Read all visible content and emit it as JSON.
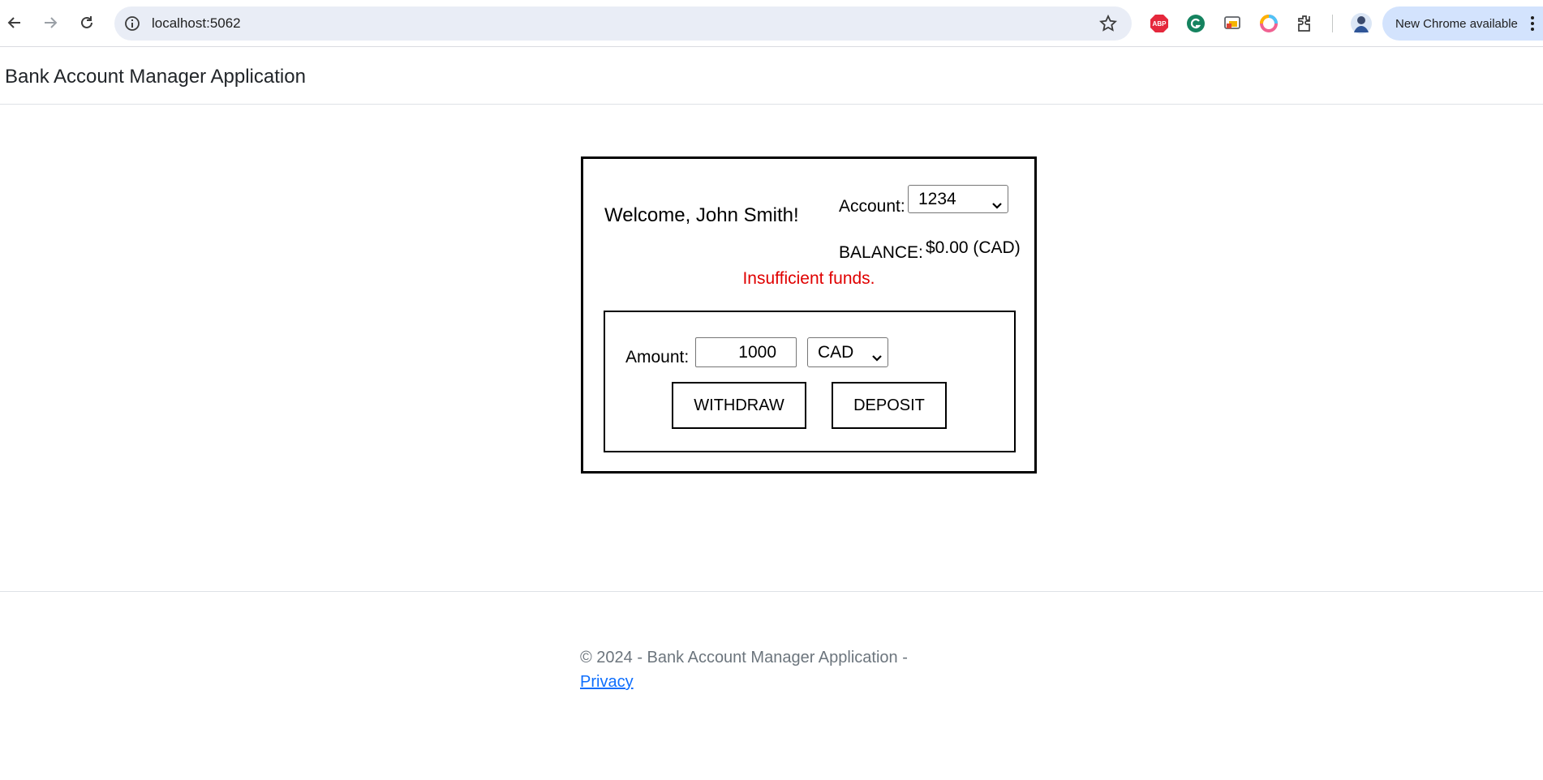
{
  "browser": {
    "url": "localhost:5062",
    "update_label": "New Chrome available",
    "extensions": [
      "adblock-icon",
      "grammarly-icon",
      "cast-icon",
      "color-picker-icon",
      "extensions-icon"
    ]
  },
  "app": {
    "brand": "Bank Account Manager Application"
  },
  "panel": {
    "welcome": "Welcome, John Smith!",
    "account_label": "Account:",
    "account_selected": "1234",
    "balance_label": "BALANCE:",
    "balance_value": "$0.00 (CAD)",
    "error": "Insufficient funds.",
    "error_color": "#e00000"
  },
  "transaction": {
    "amount_label": "Amount:",
    "amount_value": "1000",
    "currency_selected": "CAD",
    "withdraw_label": "WITHDRAW",
    "deposit_label": "DEPOSIT"
  },
  "footer": {
    "text": "© 2024 - Bank Account Manager Application -",
    "privacy_link": "Privacy"
  }
}
